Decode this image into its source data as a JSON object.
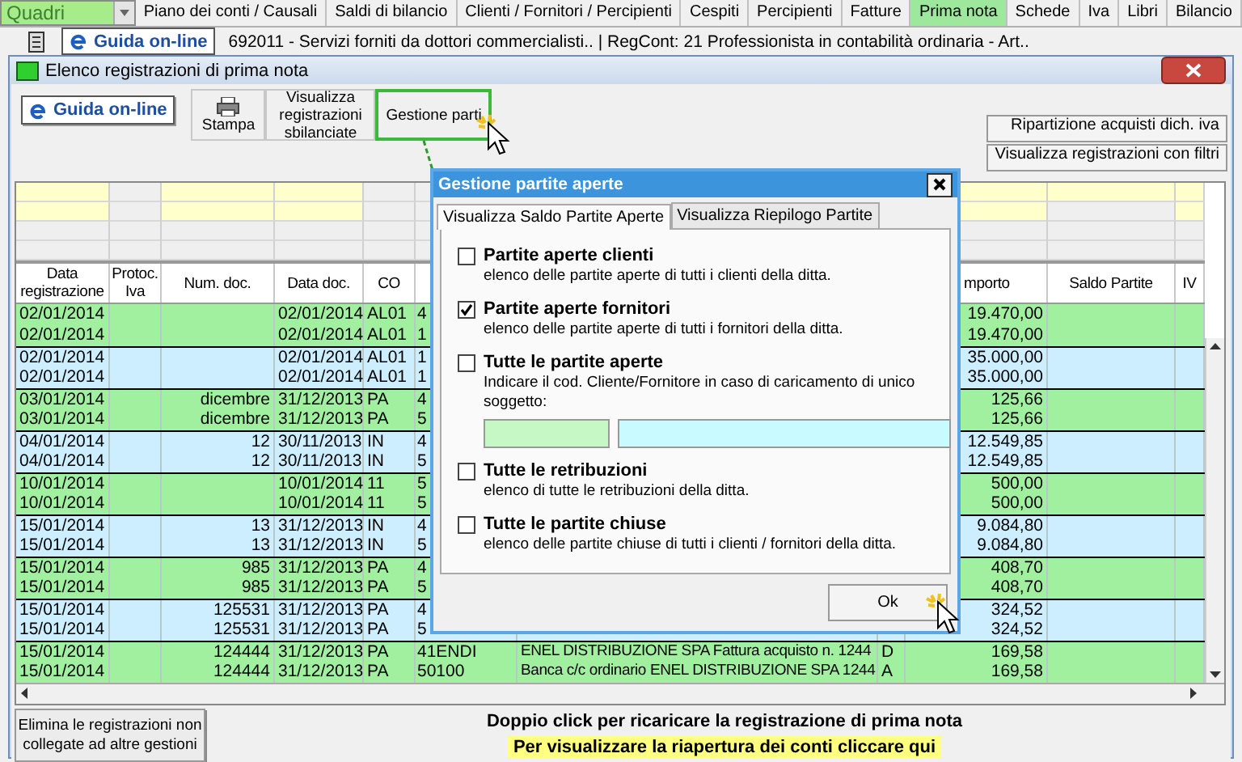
{
  "top_bar": {
    "dropdown": {
      "value": "Quadri"
    },
    "tabs": [
      {
        "label": "Piano dei conti / Causali",
        "selected": false
      },
      {
        "label": "Saldi di bilancio",
        "selected": false
      },
      {
        "label": "Clienti / Fornitori / Percipienti",
        "selected": false
      },
      {
        "label": "Cespiti",
        "selected": false
      },
      {
        "label": "Percipienti",
        "selected": false
      },
      {
        "label": "Fatture",
        "selected": false
      },
      {
        "label": "Prima nota",
        "selected": true
      },
      {
        "label": "Schede",
        "selected": false
      },
      {
        "label": "Iva",
        "selected": false
      },
      {
        "label": "Libri",
        "selected": false
      },
      {
        "label": "Bilancio",
        "selected": false
      }
    ]
  },
  "info_bar": {
    "help_button": "Guida on-line",
    "company": "692011 - Servizi forniti da dottori commercialisti.. | RegCont: 21 Professionista in contabilità ordinaria - Art.."
  },
  "window": {
    "title": "Elenco registrazioni di prima nota",
    "toolbar": {
      "help_button": "Guida on-line",
      "buttons": [
        {
          "label": "Stampa",
          "kind": "print",
          "highlighted": false
        },
        {
          "label": "Visualizza registrazioni sbilanciate",
          "kind": "text",
          "highlighted": false
        },
        {
          "label": "Gestione parti",
          "kind": "text",
          "highlighted": true
        }
      ],
      "right_buttons": [
        "Ripartizione acquisti dich. iva",
        "Visualizza registrazioni con filtri"
      ]
    },
    "table": {
      "columns_left": [
        "Data registrazione",
        "Protoc. Iva",
        "Num. doc.",
        "Data doc.",
        "CO"
      ],
      "columns_right": [
        "mporto",
        "Saldo Partite",
        "IV"
      ],
      "rows": [
        {
          "date": "02/01/2014",
          "doc_date": "02/01/2014",
          "co": "AL01",
          "account": "4",
          "amount": "19.470,00",
          "color": "#a0f0a0"
        },
        {
          "date": "02/01/2014",
          "doc_date": "02/01/2014",
          "co": "AL01",
          "account": "1",
          "amount": "19.470,00",
          "color": "#a0f0a0"
        },
        {
          "date": "02/01/2014",
          "doc_date": "02/01/2014",
          "co": "AL01",
          "account": "1",
          "amount": "35.000,00",
          "color": "#cceeff"
        },
        {
          "date": "02/01/2014",
          "doc_date": "02/01/2014",
          "co": "AL01",
          "account": "1",
          "amount": "35.000,00",
          "color": "#cceeff"
        },
        {
          "date": "03/01/2014",
          "num_doc": "dicembre",
          "doc_date": "31/12/2013",
          "co": "PA",
          "account": "4",
          "amount": "125,66",
          "color": "#a0f0a0"
        },
        {
          "date": "03/01/2014",
          "num_doc": "dicembre",
          "doc_date": "31/12/2013",
          "co": "PA",
          "account": "5",
          "amount": "125,66",
          "color": "#a0f0a0"
        },
        {
          "date": "04/01/2014",
          "num_doc": "12",
          "doc_date": "30/11/2013",
          "co": "IN",
          "account": "4",
          "amount": "12.549,85",
          "color": "#cceeff"
        },
        {
          "date": "04/01/2014",
          "num_doc": "12",
          "doc_date": "30/11/2013",
          "co": "IN",
          "account": "5",
          "amount": "12.549,85",
          "color": "#cceeff"
        },
        {
          "date": "10/01/2014",
          "doc_date": "10/01/2014",
          "co": "11",
          "account": "5",
          "amount": "500,00",
          "color": "#a0f0a0"
        },
        {
          "date": "10/01/2014",
          "doc_date": "10/01/2014",
          "co": "11",
          "account": "5",
          "amount": "500,00",
          "color": "#a0f0a0"
        },
        {
          "date": "15/01/2014",
          "num_doc": "13",
          "doc_date": "31/12/2013",
          "co": "IN",
          "account": "4",
          "amount": "9.084,80",
          "color": "#cceeff"
        },
        {
          "date": "15/01/2014",
          "num_doc": "13",
          "doc_date": "31/12/2013",
          "co": "IN",
          "account": "5",
          "amount": "9.084,80",
          "color": "#cceeff"
        },
        {
          "date": "15/01/2014",
          "num_doc": "985",
          "doc_date": "31/12/2013",
          "co": "PA",
          "account": "4",
          "amount": "408,70",
          "color": "#a0f0a0"
        },
        {
          "date": "15/01/2014",
          "num_doc": "985",
          "doc_date": "31/12/2013",
          "co": "PA",
          "account": "5",
          "amount": "408,70",
          "color": "#a0f0a0"
        },
        {
          "date": "15/01/2014",
          "num_doc": "125531",
          "doc_date": "31/12/2013",
          "co": "PA",
          "account": "4",
          "amount": "324,52",
          "color": "#cceeff"
        },
        {
          "date": "15/01/2014",
          "num_doc": "125531",
          "doc_date": "31/12/2013",
          "co": "PA",
          "account": "5",
          "amount": "324,52",
          "color": "#cceeff"
        },
        {
          "date": "15/01/2014",
          "num_doc": "124444",
          "doc_date": "31/12/2013",
          "co": "PA",
          "account": "41ENDI",
          "description": "ENEL DISTRIBUZIONE SPA Fattura acquisto n. 1244",
          "dc": "D",
          "amount": "169,58",
          "color": "#a0f0a0"
        },
        {
          "date": "15/01/2014",
          "num_doc": "124444",
          "doc_date": "31/12/2013",
          "co": "PA",
          "account": "50100",
          "description": "Banca c/c ordinario ENEL DISTRIBUZIONE SPA 1244",
          "dc": "A",
          "amount": "169,58",
          "color": "#a0f0a0"
        }
      ]
    },
    "footer": {
      "button": "Elimina le registrazioni non collegate ad altre gestioni",
      "hint": "Doppio click per ricaricare la registrazione di prima nota",
      "link": "Per visualizzare la riapertura dei conti cliccare qui"
    }
  },
  "dialog": {
    "title": "Gestione partite aperte",
    "tabs": [
      {
        "label": "Visualizza Saldo Partite Aperte",
        "selected": true
      },
      {
        "label": "Visualizza Riepilogo Partite",
        "selected": false
      }
    ],
    "options": [
      {
        "label": "Partite aperte clienti",
        "description": "elenco delle partite aperte di tutti i clienti della ditta.",
        "checked": false,
        "kind": "plain"
      },
      {
        "label": "Partite aperte fornitori",
        "description": "elenco delle partite aperte di tutti i fornitori della ditta.",
        "checked": true,
        "kind": "plain"
      },
      {
        "label": "Tutte le partite aperte",
        "description": "Indicare il cod. Cliente/Fornitore in caso di caricamento di unico soggetto:",
        "checked": false,
        "kind": "fields"
      },
      {
        "label": "Tutte le retribuzioni",
        "description": "elenco di tutte le retribuzioni della ditta.",
        "checked": false,
        "kind": "plain"
      },
      {
        "label": "Tutte le partite chiuse",
        "description": "elenco delle partite chiuse di tutti i clienti / fornitori della ditta.",
        "checked": false,
        "kind": "plain"
      }
    ],
    "ok_button": "Ok"
  }
}
